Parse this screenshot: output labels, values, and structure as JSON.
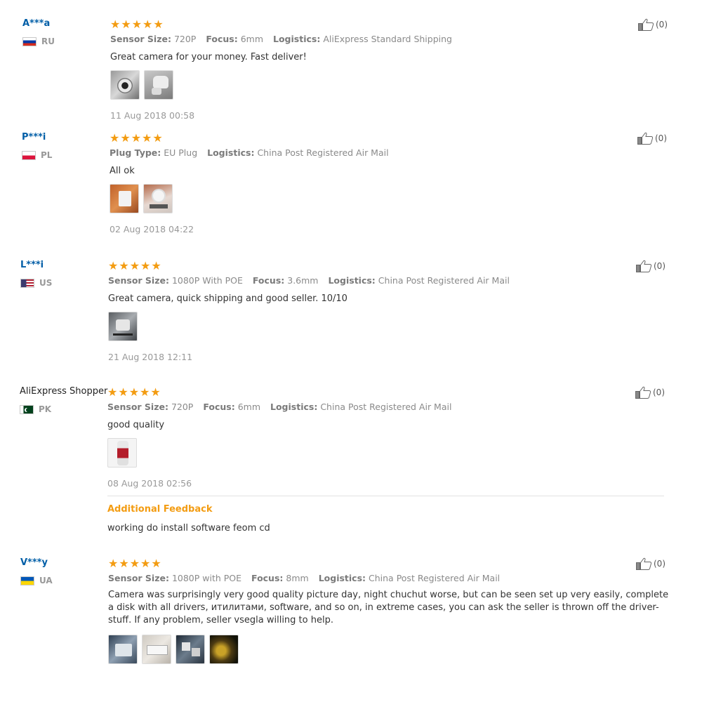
{
  "reviews": [
    {
      "user": "A***a",
      "country": "RU",
      "stars": "★★★★★",
      "attrs": [
        {
          "label": "Sensor Size:",
          "value": "720P"
        },
        {
          "label": "Focus:",
          "value": "6mm"
        },
        {
          "label": "Logistics:",
          "value": "AliExpress Standard Shipping"
        }
      ],
      "text": "Great camera for your money. Fast deliver!",
      "date": "11 Aug 2018 00:58",
      "likes": "(0)"
    },
    {
      "user": "P***i",
      "country": "PL",
      "stars": "★★★★★",
      "attrs": [
        {
          "label": "Plug Type:",
          "value": "EU Plug"
        },
        {
          "label": "Logistics:",
          "value": "China Post Registered Air Mail"
        }
      ],
      "text": "All ok",
      "date": "02 Aug 2018 04:22",
      "likes": "(0)"
    },
    {
      "user": "L***i",
      "country": "US",
      "stars": "★★★★★",
      "attrs": [
        {
          "label": "Sensor Size:",
          "value": "1080P With POE"
        },
        {
          "label": "Focus:",
          "value": "3.6mm"
        },
        {
          "label": "Logistics:",
          "value": "China Post Registered Air Mail"
        }
      ],
      "text": "Great camera, quick shipping and good seller. 10/10",
      "date": "21 Aug 2018 12:11",
      "likes": "(0)"
    },
    {
      "user": "AliExpress Shopper",
      "country": "PK",
      "stars": "★★★★★",
      "attrs": [
        {
          "label": "Sensor Size:",
          "value": "720P"
        },
        {
          "label": "Focus:",
          "value": "6mm"
        },
        {
          "label": "Logistics:",
          "value": "China Post Registered Air Mail"
        }
      ],
      "text": "good quality",
      "date": "08 Aug 2018 02:56",
      "additional_title": "Additional Feedback",
      "additional_text": "working do install software feom cd",
      "likes": "(0)"
    },
    {
      "user": "V***y",
      "country": "UA",
      "stars": "★★★★★",
      "attrs": [
        {
          "label": "Sensor Size:",
          "value": "1080P with POE"
        },
        {
          "label": "Focus:",
          "value": "8mm"
        },
        {
          "label": "Logistics:",
          "value": "China Post Registered Air Mail"
        }
      ],
      "text": "Camera was surprisingly very good quality picture day, night chuchut worse, but can be seen set up very easily, complete a disk with all drivers, итилитами, software, and so on, in extreme cases, you can ask the seller is thrown off the driver-stuff. If any problem, seller vsegla willing to help.",
      "likes": "(0)"
    }
  ]
}
